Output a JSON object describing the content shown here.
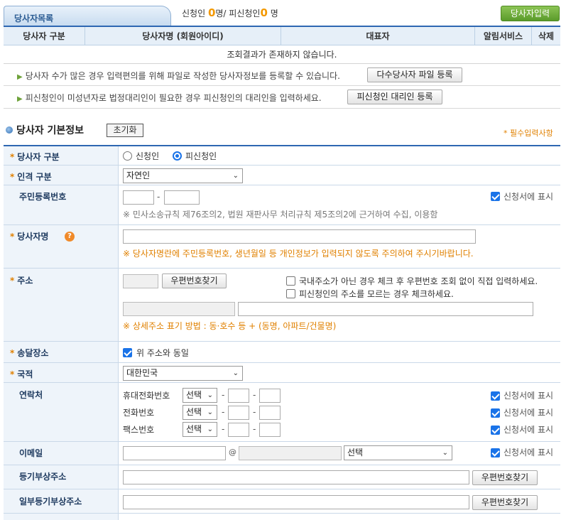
{
  "header": {
    "tab_label": "당사자목록",
    "status_prefix": "신청인",
    "applicant_count": "0",
    "status_mid": "명/ 피신청인",
    "respondent_count": "0",
    "status_suffix": "명",
    "add_party_button": "당사자입력"
  },
  "list_table": {
    "columns": [
      "당사자 구분",
      "당사자명 (회원아이디)",
      "대표자",
      "알림서비스",
      "삭제"
    ],
    "empty_message": "조회결과가 존재하지 않습니다."
  },
  "notices": {
    "bulk_text": "당사자 수가 많은 경우 입력편의를 위해 파일로 작성한 당사자정보를 등록할 수 있습니다.",
    "bulk_button": "다수당사자 파일 등록",
    "proxy_text": "피신청인이 미성년자로 법정대리인이 필요한 경우 피신청인의 대리인을 입력하세요.",
    "proxy_button": "피신청인 대리인 등록"
  },
  "section": {
    "title": "당사자 기본정보",
    "reset_button": "초기화",
    "required_note": "* 필수입력사항"
  },
  "form": {
    "party_type": {
      "label": "당사자 구분",
      "options": [
        "신청인",
        "피신청인"
      ],
      "selected": "피신청인"
    },
    "person_type": {
      "label": "인격 구분",
      "value": "자연인"
    },
    "resident_no": {
      "label": "주민등록번호",
      "hint": "※ 민사소송규칙 제76조의2, 법원 재판사무 처리규칙 제5조의2에 근거하여 수집, 이용함",
      "show_label": "신청서에 표시"
    },
    "party_name": {
      "label": "당사자명",
      "warning": "※ 당사자명란에 주민등록번호, 생년월일 등 개인정보가 입력되지 않도록 주의하여 주시기바랍니다."
    },
    "address": {
      "label": "주소",
      "zip_button": "우편번호찾기",
      "foreign_check": "국내주소가 아닌 경우 체크 후 우편번호 조회 없이 직접 입력하세요.",
      "unknown_check": "피신청인의 주소를 모르는 경우 체크하세요.",
      "detail_hint": "※ 상세주소 표기 방법 : 동·호수 등 + (동명, 아파트/건물명)"
    },
    "delivery": {
      "label": "송달장소",
      "same_check": "위 주소와 동일"
    },
    "nationality": {
      "label": "국적",
      "value": "대한민국"
    },
    "contact": {
      "label": "연락처",
      "rows": [
        {
          "label": "휴대전화번호",
          "select": "선택",
          "show_label": "신청서에 표시"
        },
        {
          "label": "전화번호",
          "select": "선택",
          "show_label": "신청서에 표시"
        },
        {
          "label": "팩스번호",
          "select": "선택",
          "show_label": "신청서에 표시"
        }
      ]
    },
    "email": {
      "label": "이메일",
      "at": "@",
      "domain_select": "선택",
      "show_label": "신청서에 표시"
    },
    "reg_address": {
      "label": "등기부상주소",
      "zip_button": "우편번호찾기"
    },
    "partial_reg_address": {
      "label": "일부등기부상주소",
      "zip_button": "우편번호찾기"
    }
  }
}
